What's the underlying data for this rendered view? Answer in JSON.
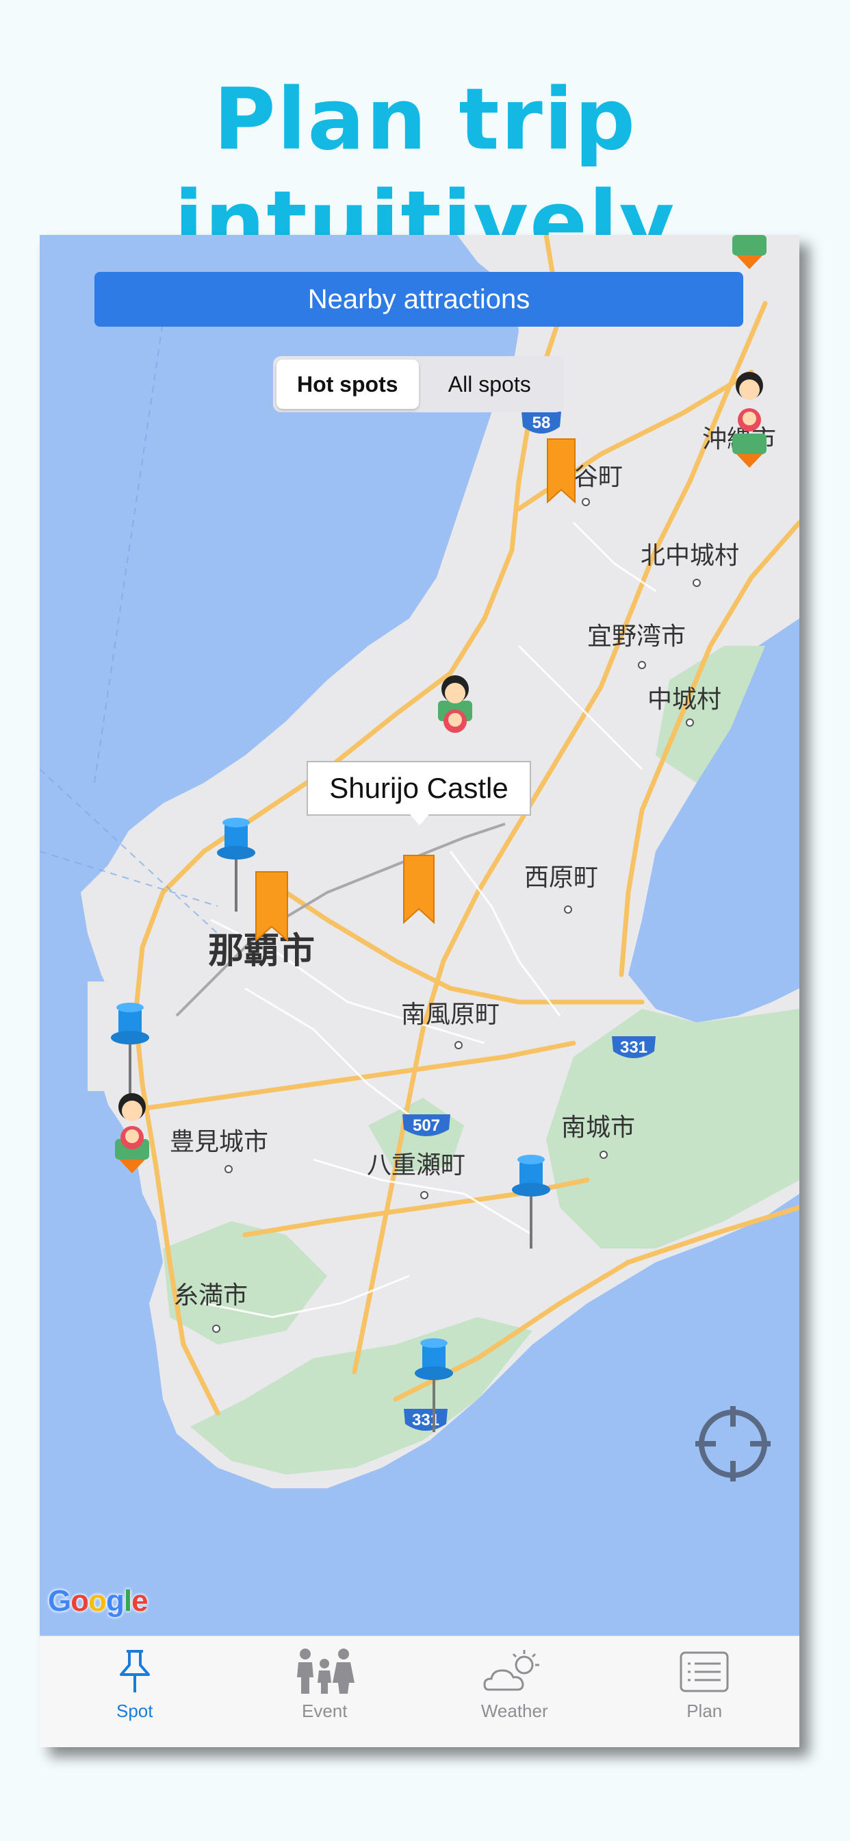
{
  "headline": "Plan trip intuitively",
  "map": {
    "banner": "Nearby attractions",
    "segments": [
      {
        "label": "Hot spots",
        "active": true
      },
      {
        "label": "All spots",
        "active": false
      }
    ],
    "callout": "Shurijo Castle",
    "places": {
      "naha": "那覇市",
      "okinawa": "沖縄市",
      "chatan": "谷町",
      "kitanakagusuku": "北中城村",
      "ginowan": "宜野湾市",
      "nakagusuku": "中城村",
      "nishihara": "西原町",
      "haebaru": "南風原町",
      "tomigusuku": "豊見城市",
      "yaese": "八重瀬町",
      "nanjo": "南城市",
      "itoman": "糸満市"
    },
    "routes": [
      "58",
      "331",
      "507",
      "331"
    ],
    "attribution": "Google",
    "colors": {
      "water": "#9dc0f4",
      "land": "#e9e9ec",
      "park": "#c6e2c7",
      "road": "#f6c264",
      "accent": "#2f7be6",
      "marker": "#f99a1c"
    }
  },
  "tabs": [
    {
      "label": "Spot",
      "icon": "pin-icon",
      "active": true
    },
    {
      "label": "Event",
      "icon": "people-icon",
      "active": false
    },
    {
      "label": "Weather",
      "icon": "weather-icon",
      "active": false
    },
    {
      "label": "Plan",
      "icon": "list-icon",
      "active": false
    }
  ],
  "colors": {
    "headline": "#13b9e2",
    "tab_active": "#1a7bd9",
    "tab_inactive": "#8e8e93"
  }
}
